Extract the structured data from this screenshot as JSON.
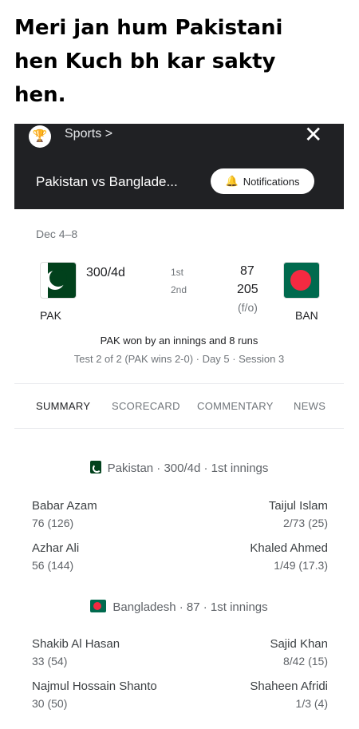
{
  "caption": {
    "line1": "Meri jan hum Pakistani",
    "line2": "hen Kuch bh kar sakty",
    "line3": "hen."
  },
  "header": {
    "trophy_icon": "trophy-icon",
    "sports_link": "Sports >",
    "close_label": "✕",
    "match_title": "Pakistan vs Banglade...",
    "notifications_label": "Notifications",
    "bell_icon": "bell-icon"
  },
  "match": {
    "date": "Dec 4–8",
    "home": {
      "abbr": "PAK",
      "score": "300/4d"
    },
    "away": {
      "abbr": "BAN",
      "score1": "87",
      "score2": "205",
      "note": "(f/o)"
    },
    "innings1_label": "1st",
    "innings2_label": "2nd",
    "result": "PAK won by an innings and 8 runs",
    "series": "Test 2 of 2 (PAK wins 2-0) · Day 5 · Session 3"
  },
  "tabs": [
    "SUMMARY",
    "SCORECARD",
    "COMMENTARY",
    "NEWS"
  ],
  "innings": [
    {
      "heading": "Pakistan · 300/4d · 1st innings",
      "left": [
        {
          "name": "Babar Azam",
          "stat": "76 (126)"
        },
        {
          "name": "Azhar Ali",
          "stat": "56 (144)"
        }
      ],
      "right": [
        {
          "name": "Taijul Islam",
          "stat": "2/73 (25)"
        },
        {
          "name": "Khaled Ahmed",
          "stat": "1/49 (17.3)"
        }
      ]
    },
    {
      "heading": "Bangladesh · 87 · 1st innings",
      "left": [
        {
          "name": "Shakib Al Hasan",
          "stat": "33 (54)"
        },
        {
          "name": "Najmul Hossain Shanto",
          "stat": "30 (50)"
        }
      ],
      "right": [
        {
          "name": "Sajid Khan",
          "stat": "8/42 (15)"
        },
        {
          "name": "Shaheen Afridi",
          "stat": "1/3 (4)"
        }
      ]
    }
  ],
  "colors": {
    "header_bg": "#202124",
    "pak_green": "#01411c",
    "ban_green": "#006a4e",
    "ban_red": "#f42a41"
  }
}
